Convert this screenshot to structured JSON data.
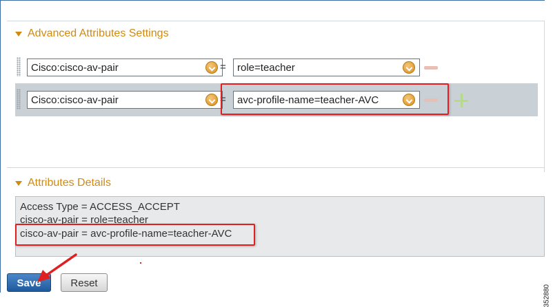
{
  "advanced": {
    "title": "Advanced Attributes Settings",
    "rows": [
      {
        "attribute": "Cisco:cisco-av-pair",
        "operator": "=",
        "value": "role=teacher"
      },
      {
        "attribute": "Cisco:cisco-av-pair",
        "operator": "=",
        "value": "avc-profile-name=teacher-AVC"
      }
    ]
  },
  "details": {
    "title": "Attributes Details",
    "lines": [
      "Access Type = ACCESS_ACCEPT",
      "cisco-av-pair = role=teacher",
      "cisco-av-pair = avc-profile-name=teacher-AVC"
    ]
  },
  "buttons": {
    "save": "Save",
    "reset": "Reset"
  },
  "figure_id": "352880",
  "colors": {
    "accent": "#d08a10",
    "highlight": "#e02020",
    "primary": "#1f5a9e"
  }
}
